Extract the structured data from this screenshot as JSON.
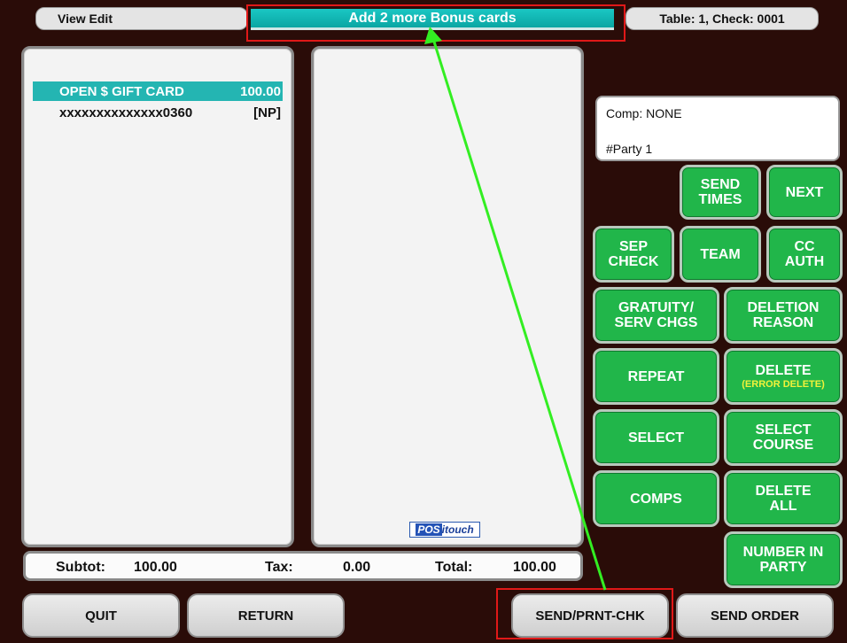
{
  "header": {
    "left_label": "View Edit",
    "message": "Add 2 more Bonus cards",
    "table_check": "Table:  1, Check: 0001"
  },
  "check": {
    "items": [
      {
        "name": "OPEN $ GIFT CARD",
        "amount": "100.00",
        "selected": true
      },
      {
        "name": "xxxxxxxxxxxxxx0360",
        "amount": "[NP]",
        "selected": false
      }
    ]
  },
  "branding": {
    "logo_part1": "POS",
    "logo_part2": "itouch"
  },
  "totals": {
    "subtotal_label": "Subtot:",
    "subtotal": "100.00",
    "tax_label": "Tax:",
    "tax": "0.00",
    "total_label": "Total:",
    "total": "100.00"
  },
  "info": {
    "comp": "Comp: NONE",
    "party": "#Party  1"
  },
  "buttons": {
    "send_times": [
      "SEND",
      "TIMES"
    ],
    "next": "NEXT",
    "sep_check": [
      "SEP",
      "CHECK"
    ],
    "team": "TEAM",
    "cc_auth": [
      "CC",
      "AUTH"
    ],
    "gratuity": [
      "GRATUITY/",
      "SERV CHGS"
    ],
    "deletion_reason": [
      "DELETION",
      "REASON"
    ],
    "repeat": "REPEAT",
    "delete": "DELETE",
    "delete_sub": "(ERROR DELETE)",
    "select": "SELECT",
    "select_course": [
      "SELECT",
      "COURSE"
    ],
    "comps": "COMPS",
    "delete_all": [
      "DELETE",
      "ALL"
    ],
    "number_in_party": [
      "NUMBER IN",
      "PARTY"
    ]
  },
  "bottom": {
    "quit": "QUIT",
    "return": "RETURN",
    "send_print": "SEND/PRNT-CHK",
    "send_order": "SEND  ORDER"
  },
  "colors": {
    "background": "#2a0c08",
    "accent_teal": "#24b5b2",
    "button_green": "#21b64a",
    "annotation_red": "#e01818",
    "annotation_arrow": "#33ee22"
  }
}
